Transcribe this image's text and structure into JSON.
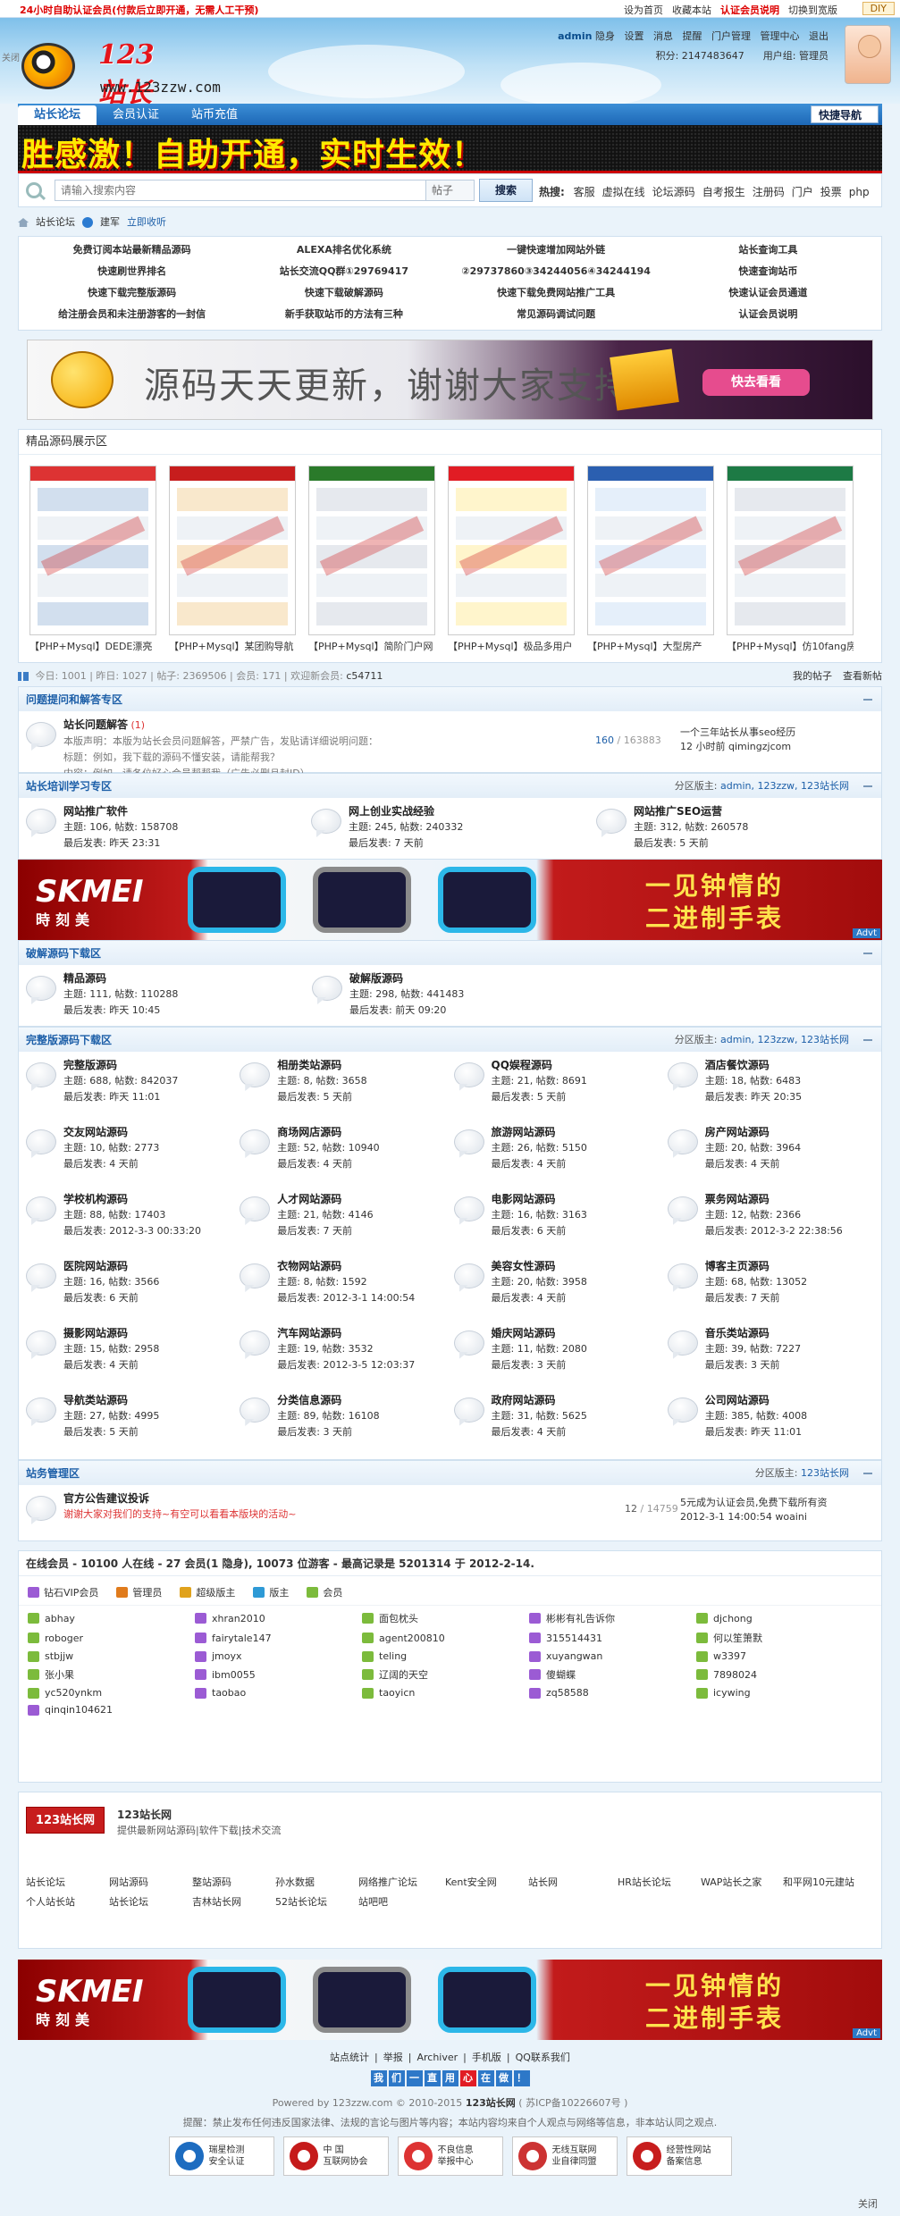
{
  "topbar": {
    "promo": "24小时自助认证会员(付款后立即开通，无需人工干预)",
    "links": [
      "设为首页",
      "收藏本站",
      "认证会员说明",
      "切换到宽版"
    ],
    "diy": "DIY",
    "close": "关闭"
  },
  "header": {
    "site_name": "123站长网",
    "url": "www.123zzw.com",
    "user": "admin",
    "status": "隐身",
    "menu": [
      "设置",
      "消息",
      "提醒",
      "门户管理",
      "管理中心",
      "退出"
    ],
    "points_label": "积分: 2147483647",
    "group_label": "用户组: 管理员"
  },
  "nav": {
    "tabs": [
      "站长论坛",
      "会员认证",
      "站币充值"
    ],
    "quick": "快捷导航"
  },
  "banner_text": "胜感激！自助开通，实时生效！",
  "search": {
    "placeholder": "请输入搜索内容",
    "scope": "帖子",
    "button": "搜索",
    "hot_label": "热搜:",
    "hot": [
      "客服",
      "虚拟在线",
      "论坛源码",
      "自考报生",
      "注册码",
      "门户",
      "投票",
      "php"
    ]
  },
  "breadcrumb": {
    "forum": "站长论坛",
    "sub": "建军",
    "fav": "立即收听"
  },
  "quicklinks": [
    "免费订阅本站最新精品源码",
    "ALEXA排名优化系统",
    "一键快速增加网站外链",
    "站长查询工具",
    "快速刷世界排名",
    "站长交流QQ群①29769417",
    "②29737860③34244056④34244194",
    "快速查询站币",
    "快速下载完整版源码",
    "快速下载破解源码",
    "快速下载免费网站推广工具",
    "快速认证会员通道",
    "给注册会员和未注册游客的一封信",
    "新手获取站币的方法有三种",
    "常见源码调试问题",
    "认证会员说明"
  ],
  "ad_banner": {
    "text": "源码天天更新，谢谢大家支持",
    "button": "快去看看"
  },
  "showcase": {
    "title": "精品源码展示区",
    "items": [
      "【PHP+Mysql】DEDE漂亮",
      "【PHP+Mysql】某团购导航",
      "【PHP+Mysql】简阶门户网",
      "【PHP+Mysql】极品多用户",
      "【PHP+Mysql】大型房产",
      "【PHP+Mysql】仿10fang房"
    ]
  },
  "stats": {
    "today": "今日: 1001",
    "yesterday": "昨日: 1027",
    "posts": "帖子: 2369506",
    "members": "会员: 171",
    "newest_label": "欢迎新会员:",
    "newest": "c54711",
    "my_posts": "我的帖子",
    "new_posts": "查看新帖"
  },
  "sec_qa": {
    "title": "问题提问和解答专区",
    "forum": {
      "name": "站长问题解答",
      "count": "(1)",
      "desc": [
        "本版声明：本版为站长会员问题解答，严禁广告，发贴请详细说明问题：",
        "标题：例如，我下载的源码不懂安装，请能帮我？",
        "内容：例如，请各位好心会员帮帮我（广告必删且封ID）"
      ],
      "stat1": "160",
      "stat2": "/ 163883",
      "last_title": "一个三年站长从事seo经历",
      "last_time": "12 小时前",
      "last_user": "qimingzjcom"
    }
  },
  "sec_train": {
    "title": "站长培训学习专区",
    "mods_label": "分区版主:",
    "mods": "admin, 123zzw, 123站长网",
    "forums": [
      {
        "name": "网站推广软件",
        "stats": "主题: 106, 帖数: 158708",
        "last": "最后发表: 昨天 23:31"
      },
      {
        "name": "网上创业实战经验",
        "stats": "主题: 245, 帖数: 240332",
        "last": "最后发表: 7 天前"
      },
      {
        "name": "网站推广SEO运营",
        "stats": "主题: 312, 帖数: 260578",
        "last": "最后发表: 5 天前"
      }
    ]
  },
  "skmei": {
    "brand": "SKMEI",
    "brand_cn": "時刻美",
    "slogan1": "一见钟情的",
    "slogan2": "二进制手表",
    "adv": "Advt"
  },
  "sec_crack": {
    "title": "破解源码下载区",
    "forums": [
      {
        "name": "精品源码",
        "stats": "主题: 111, 帖数: 110288",
        "last": "最后发表: 昨天 10:45"
      },
      {
        "name": "破解版源码",
        "stats": "主题: 298, 帖数: 441483",
        "last": "最后发表: 前天 09:20"
      }
    ]
  },
  "sec_full": {
    "title": "完整版源码下载区",
    "mods_label": "分区版主:",
    "mods": "admin, 123zzw, 123站长网",
    "forums": [
      {
        "name": "完整版源码",
        "stats": "主题: 688, 帖数: 842037",
        "last": "最后发表: 昨天 11:01"
      },
      {
        "name": "相册类站源码",
        "stats": "主题: 8, 帖数: 3658",
        "last": "最后发表: 5 天前"
      },
      {
        "name": "QQ娱程源码",
        "stats": "主题: 21, 帖数: 8691",
        "last": "最后发表: 5 天前"
      },
      {
        "name": "酒店餐饮源码",
        "stats": "主题: 18, 帖数: 6483",
        "last": "最后发表: 昨天 20:35"
      },
      {
        "name": "交友网站源码",
        "stats": "主题: 10, 帖数: 2773",
        "last": "最后发表: 4 天前"
      },
      {
        "name": "商场网店源码",
        "stats": "主题: 52, 帖数: 10940",
        "last": "最后发表: 4 天前"
      },
      {
        "name": "旅游网站源码",
        "stats": "主题: 26, 帖数: 5150",
        "last": "最后发表: 4 天前"
      },
      {
        "name": "房产网站源码",
        "stats": "主题: 20, 帖数: 3964",
        "last": "最后发表: 4 天前"
      },
      {
        "name": "学校机构源码",
        "stats": "主题: 88, 帖数: 17403",
        "last": "最后发表: 2012-3-3 00:33:20"
      },
      {
        "name": "人才网站源码",
        "stats": "主题: 21, 帖数: 4146",
        "last": "最后发表: 7 天前"
      },
      {
        "name": "电影网站源码",
        "stats": "主题: 16, 帖数: 3163",
        "last": "最后发表: 6 天前"
      },
      {
        "name": "票务网站源码",
        "stats": "主题: 12, 帖数: 2366",
        "last": "最后发表: 2012-3-2 22:38:56"
      },
      {
        "name": "医院网站源码",
        "stats": "主题: 16, 帖数: 3566",
        "last": "最后发表: 6 天前"
      },
      {
        "name": "衣物网站源码",
        "stats": "主题: 8, 帖数: 1592",
        "last": "最后发表: 2012-3-1 14:00:54"
      },
      {
        "name": "美容女性源码",
        "stats": "主题: 20, 帖数: 3958",
        "last": "最后发表: 4 天前"
      },
      {
        "name": "博客主页源码",
        "stats": "主题: 68, 帖数: 13052",
        "last": "最后发表: 7 天前"
      },
      {
        "name": "摄影网站源码",
        "stats": "主题: 15, 帖数: 2958",
        "last": "最后发表: 4 天前"
      },
      {
        "name": "汽车网站源码",
        "stats": "主题: 19, 帖数: 3532",
        "last": "最后发表: 2012-3-5 12:03:37"
      },
      {
        "name": "婚庆网站源码",
        "stats": "主题: 11, 帖数: 2080",
        "last": "最后发表: 3 天前"
      },
      {
        "name": "音乐类站源码",
        "stats": "主题: 39, 帖数: 7227",
        "last": "最后发表: 3 天前"
      },
      {
        "name": "导航类站源码",
        "stats": "主题: 27, 帖数: 4995",
        "last": "最后发表: 5 天前"
      },
      {
        "name": "分类信息源码",
        "stats": "主题: 89, 帖数: 16108",
        "last": "最后发表: 3 天前"
      },
      {
        "name": "政府网站源码",
        "stats": "主题: 31, 帖数: 5625",
        "last": "最后发表: 4 天前"
      },
      {
        "name": "公司网站源码",
        "stats": "主题: 385, 帖数: 4008",
        "last": "最后发表: 昨天 11:01"
      }
    ]
  },
  "sec_admin": {
    "title": "站务管理区",
    "mods_label": "分区版主:",
    "mods": "123站长网",
    "forum": {
      "name": "官方公告建议投诉",
      "desc": "谢谢大家对我们的支持~有空可以看看本版块的活动~",
      "stat1": "12",
      "stat2": "/ 14759",
      "last_title": "5元成为认证会员,免费下载所有资",
      "last_time": "2012-3-1 14:00:54",
      "last_user": "woaini"
    }
  },
  "online": {
    "title": "在线会员 - 10100 人在线 - 27 会员(1 隐身), 10073 位游客 - 最高记录是 5201314 于 2012-2-14.",
    "legend": [
      "钻石VIP会员",
      "管理员",
      "超级版主",
      "版主",
      "会员"
    ],
    "legend_colors": [
      "#9b5bd4",
      "#e07b1c",
      "#e0a21c",
      "#2e9ad6",
      "#7cbb3c"
    ],
    "users": [
      {
        "n": "abhay",
        "c": "#7cbb3c"
      },
      {
        "n": "xhran2010",
        "c": "#9b5bd4"
      },
      {
        "n": "面包枕头",
        "c": "#7cbb3c"
      },
      {
        "n": "彬彬有礼告诉你",
        "c": "#9b5bd4"
      },
      {
        "n": "djchong",
        "c": "#7cbb3c"
      },
      {
        "n": "roboger",
        "c": "#7cbb3c"
      },
      {
        "n": "fairytale147",
        "c": "#9b5bd4"
      },
      {
        "n": "agent200810",
        "c": "#7cbb3c"
      },
      {
        "n": "315514431",
        "c": "#9b5bd4"
      },
      {
        "n": "何以笙箫默",
        "c": "#7cbb3c"
      },
      {
        "n": "stbjjw",
        "c": "#7cbb3c"
      },
      {
        "n": "jmoyx",
        "c": "#9b5bd4"
      },
      {
        "n": "teling",
        "c": "#7cbb3c"
      },
      {
        "n": "xuyangwan",
        "c": "#9b5bd4"
      },
      {
        "n": "w3397",
        "c": "#7cbb3c"
      },
      {
        "n": "张小果",
        "c": "#7cbb3c"
      },
      {
        "n": "ibm0055",
        "c": "#9b5bd4"
      },
      {
        "n": "辽阔的天空",
        "c": "#7cbb3c"
      },
      {
        "n": "傻蝴蝶",
        "c": "#9b5bd4"
      },
      {
        "n": "7898024",
        "c": "#7cbb3c"
      },
      {
        "n": "yc520ynkm",
        "c": "#7cbb3c"
      },
      {
        "n": "taobao",
        "c": "#9b5bd4"
      },
      {
        "n": "taoyicn",
        "c": "#7cbb3c"
      },
      {
        "n": "zq58588",
        "c": "#9b5bd4"
      },
      {
        "n": "icywing",
        "c": "#7cbb3c"
      },
      {
        "n": "qinqin104621",
        "c": "#9b5bd4"
      }
    ]
  },
  "friend": {
    "logo": "123站长网",
    "name": "123站长网",
    "desc": "提供最新网站源码|软件下载|技术交流",
    "links": [
      "站长论坛",
      "网站源码",
      "整站源码",
      "孙水数据",
      "网络推广论坛",
      "Kent安全网",
      "站长网",
      "HR站长论坛",
      "WAP站长之家",
      "和平网10元建站",
      "个人站长站",
      "站长论坛",
      "吉林站长网",
      "52站长论坛",
      "站吧吧"
    ]
  },
  "footer": {
    "links": [
      "站点统计",
      "举报",
      "Archiver",
      "手机版",
      "QQ联系我们"
    ],
    "yes": [
      "我",
      "们",
      "一",
      "直",
      "用",
      "心",
      "在",
      "做",
      "！"
    ],
    "powered": "Powered by 123zzw.com © 2010-2015",
    "site": "123站长网",
    "icp": "( 苏ICP备10226607号 )",
    "note": "提醒：禁止发布任何违反国家法律、法规的言论与图片等内容；本站内容均来自个人观点与网络等信息，非本站认同之观点.",
    "badges": [
      {
        "l1": "瑞星检测",
        "l2": "安全认证",
        "c": "#1d6cc0"
      },
      {
        "l1": "中 国",
        "l2": "互联网协会",
        "c": "#c51b1b"
      },
      {
        "l1": "不良信息",
        "l2": "举报中心",
        "c": "#d33"
      },
      {
        "l1": "无线互联网",
        "l2": "业自律同盟",
        "c": "#c33"
      },
      {
        "l1": "经营性网站",
        "l2": "备案信息",
        "c": "#c71d1d"
      }
    ],
    "close": "关闭"
  }
}
